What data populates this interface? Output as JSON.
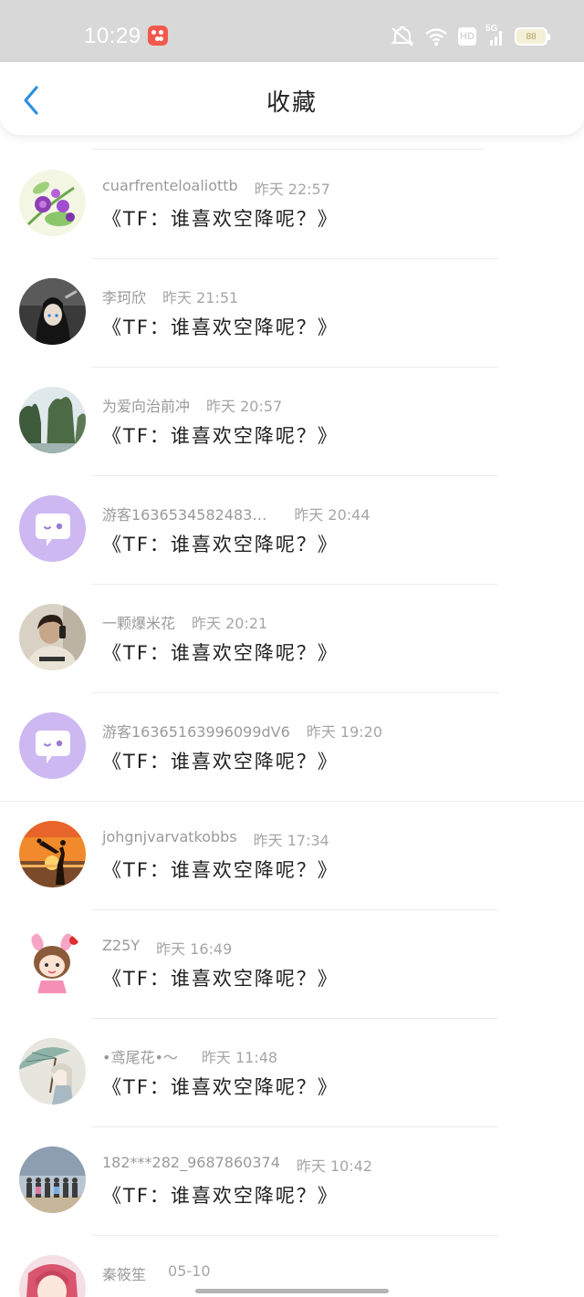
{
  "status_bar": {
    "time": "10:29",
    "network_label": "5G",
    "hd_label": "HD",
    "battery": "88",
    "icons": [
      "app-notification-icon",
      "mute-icon",
      "wifi-icon",
      "hd-icon",
      "signal-icon",
      "battery-icon"
    ]
  },
  "header": {
    "title": "收藏",
    "back_icon": "chevron-left-icon",
    "accent_color": "#2f8fe0"
  },
  "items": [
    {
      "username": "cuarfrenteloaliottb",
      "time": "昨天 22:57",
      "title": "《TF：谁喜欢空降呢？》",
      "avatar": "flower-avatar"
    },
    {
      "username": "李珂欣",
      "time": "昨天 21:51",
      "title": "《TF：谁喜欢空降呢？》",
      "avatar": "anime-character-avatar"
    },
    {
      "username": "为爱向治前冲",
      "time": "昨天 20:57",
      "title": "《TF：谁喜欢空降呢？》",
      "avatar": "mountain-landscape-avatar"
    },
    {
      "username": "游客1636534582483…",
      "time": "昨天 20:44",
      "title": "《TF：谁喜欢空降呢？》",
      "avatar": "default-chat-bubble-avatar"
    },
    {
      "username": "一颗爆米花",
      "time": "昨天 20:21",
      "title": "《TF：谁喜欢空降呢？》",
      "avatar": "selfie-photo-avatar"
    },
    {
      "username": "游客16365163996099dV6",
      "time": "昨天 19:20",
      "title": "《TF：谁喜欢空降呢？》",
      "avatar": "default-chat-bubble-avatar"
    },
    {
      "username": "johgnjvarvatkobbs",
      "time": "昨天 17:34",
      "title": "《TF：谁喜欢空降呢？》",
      "avatar": "sunset-couple-avatar"
    },
    {
      "username": "Z25Y",
      "time": "昨天 16:49",
      "title": "《TF：谁喜欢空降呢？》",
      "avatar": "cartoon-girl-avatar"
    },
    {
      "username": "•鸢尾花•～",
      "time": "昨天 11:48",
      "title": "《TF：谁喜欢空降呢？》",
      "avatar": "umbrella-girl-avatar"
    },
    {
      "username": "182***282_9687860374",
      "time": "昨天 10:42",
      "title": "《TF：谁喜欢空降呢？》",
      "avatar": "group-photo-avatar"
    },
    {
      "username": "秦筱笙",
      "time": "05-10",
      "title": "",
      "avatar": "anime-girl-avatar"
    }
  ]
}
